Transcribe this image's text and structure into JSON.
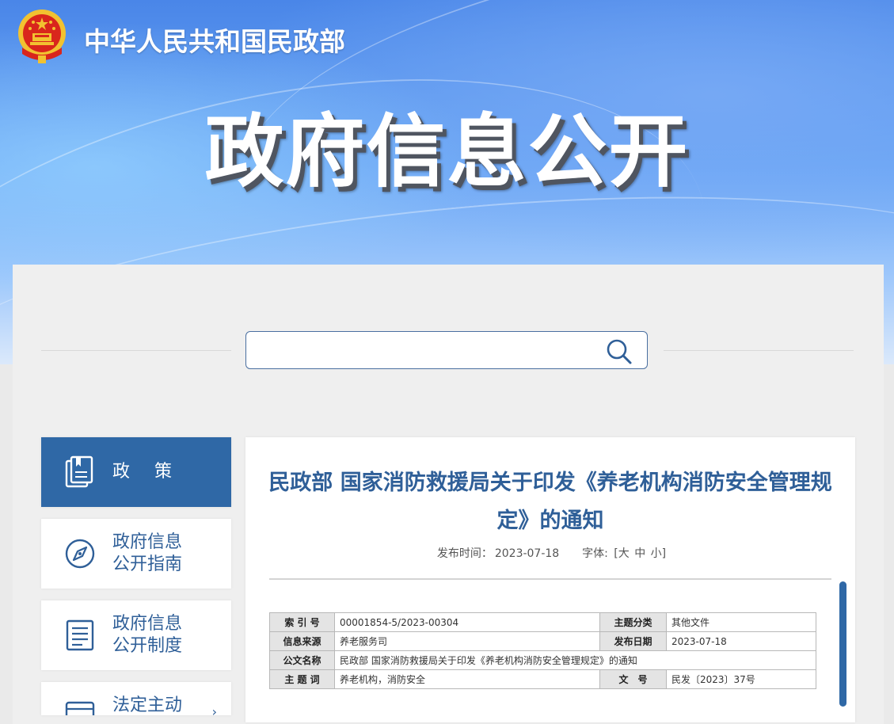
{
  "header": {
    "ministry_name": "中华人民共和国民政部",
    "page_title": "政府信息公开"
  },
  "search": {
    "placeholder": "",
    "value": ""
  },
  "sidebar": {
    "items": [
      {
        "label": "政 策",
        "icon": "document-stack-icon",
        "active": true
      },
      {
        "label": "政府信息\n公开指南",
        "icon": "compass-icon",
        "active": false
      },
      {
        "label": "政府信息\n公开制度",
        "icon": "list-document-icon",
        "active": false
      },
      {
        "label": "法定主动",
        "icon": "folder-icon",
        "active": false
      }
    ]
  },
  "article": {
    "title": "民政部 国家消防救援局关于印发《养老机构消防安全管理规定》的通知",
    "publish_label": "发布时间：",
    "publish_date": "2023-07-18",
    "font_label": "字体:",
    "font_sizes": [
      "[大",
      "中",
      "小]"
    ],
    "info": {
      "index_label": "索 引 号",
      "index_value": "00001854-5/2023-00304",
      "category_label": "主题分类",
      "category_value": "其他文件",
      "source_label": "信息来源",
      "source_value": "养老服务司",
      "date_label": "发布日期",
      "date_value": "2023-07-18",
      "doc_name_label": "公文名称",
      "doc_name_value": "民政部 国家消防救援局关于印发《养老机构消防安全管理规定》的通知",
      "keywords_label": "主 题 词",
      "keywords_value": "养老机构，消防安全",
      "doc_no_label": "文　号",
      "doc_no_value": "民发〔2023〕37号"
    }
  },
  "colors": {
    "accent": "#2f68a6",
    "title_blue": "#2f5f98",
    "emblem_red": "#d9261c",
    "emblem_gold": "#f2c230"
  }
}
